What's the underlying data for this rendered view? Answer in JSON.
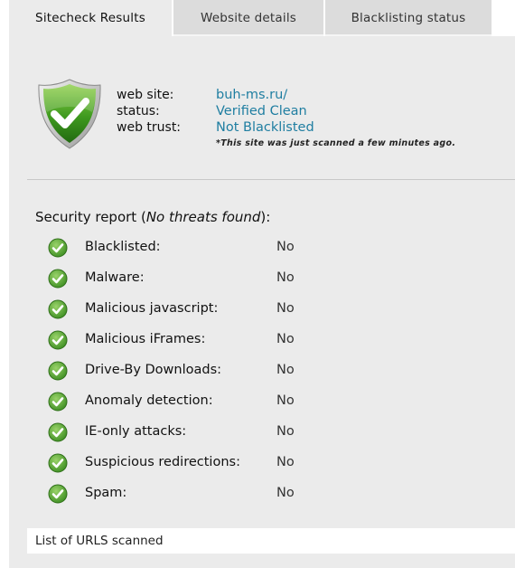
{
  "tabs": [
    {
      "label": "Sitecheck Results",
      "active": true
    },
    {
      "label": "Website details",
      "active": false
    },
    {
      "label": "Blacklisting status",
      "active": false
    }
  ],
  "summary": {
    "icon": "shield-check-icon",
    "labels": {
      "site": "web site:",
      "status": "status:",
      "trust": "web trust:"
    },
    "values": {
      "site": "buh-ms.ru/",
      "status": "Verified Clean",
      "trust": "Not Blacklisted"
    },
    "note": "*This site was just scanned a few minutes ago.",
    "value_color": "#1f7ea1"
  },
  "report": {
    "title_prefix": "Security report (",
    "title_emphasis": "No threats found",
    "title_suffix": "):",
    "items": [
      {
        "label": "Blacklisted:",
        "value": "No"
      },
      {
        "label": "Malware:",
        "value": "No"
      },
      {
        "label": "Malicious javascript:",
        "value": "No"
      },
      {
        "label": "Malicious iFrames:",
        "value": "No"
      },
      {
        "label": "Drive-By Downloads:",
        "value": "No"
      },
      {
        "label": "Anomaly detection:",
        "value": "No"
      },
      {
        "label": "IE-only attacks:",
        "value": "No"
      },
      {
        "label": "Suspicious redirections:",
        "value": "No"
      },
      {
        "label": "Spam:",
        "value": "No"
      }
    ],
    "status_icon": "green-check-icon"
  },
  "urls_link": "List of URLS scanned"
}
